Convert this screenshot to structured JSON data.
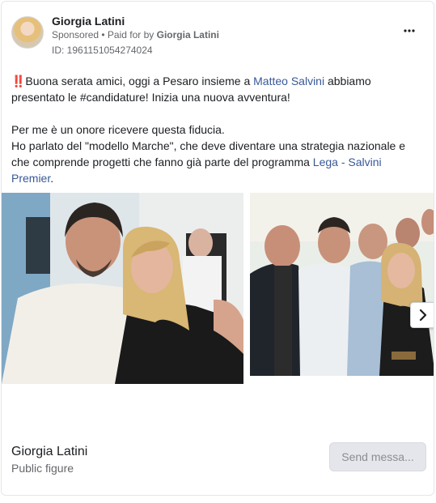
{
  "header": {
    "page_name": "Giorgia Latini",
    "sponsored": "Sponsored",
    "separator": " • ",
    "paid_for_prefix": "Paid for by ",
    "paid_for_name": "Giorgia Latini",
    "ad_id": "ID: 1961151054274024",
    "more_icon": "more-horizontal-icon"
  },
  "post": {
    "line1_a": "‼️Buona serata amici, oggi a Pesaro insieme a ",
    "line1_link": "Matteo Salvini",
    "line1_b": " abbiamo presentato le #candidature! Inizia una nuova avventura!",
    "line2": "Per me è un onore ricevere questa fiducia.",
    "line3_a": "Ho parlato del \"modello Marche\", che deve diventare una strategia nazionale e che comprende progetti che fanno già parte del programma ",
    "line3_link": "Lega - Salvini Premier",
    "line3_b": ".",
    "ellipsis": "..."
  },
  "carousel": {
    "next_icon": "chevron-right-icon"
  },
  "footer": {
    "name": "Giorgia Latini",
    "category": "Public figure",
    "send_label": "Send messa..."
  },
  "colors": {
    "link": "#385898",
    "muted": "#65676b",
    "button_bg": "#e4e6eb"
  }
}
